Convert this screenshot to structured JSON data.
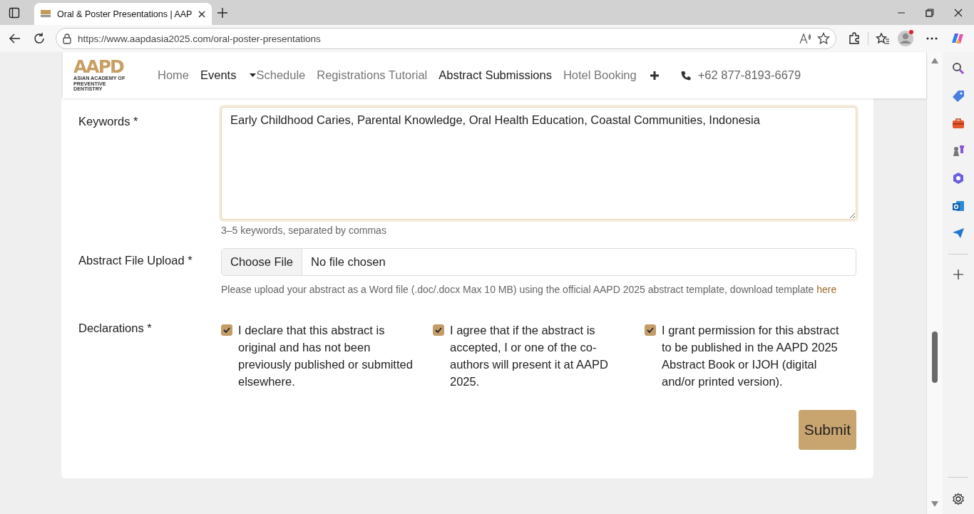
{
  "browser": {
    "tab": {
      "title": "Oral & Poster Presentations | AAP",
      "selected": true
    },
    "url": "https://www.aapdasia2025.com/oral-poster-presentations"
  },
  "site_header": {
    "logo": {
      "mark": "AAPD",
      "subtitle": "ASIAN ACADEMY OF PREVENTIVE DENTISTRY"
    },
    "nav": [
      {
        "label": "Home",
        "kind": "link",
        "selected": false
      },
      {
        "label": "Events",
        "kind": "dropdown",
        "selected": true
      },
      {
        "label": "Schedule",
        "kind": "link",
        "selected": false
      },
      {
        "label": "Registrations Tutorial",
        "kind": "link",
        "selected": false
      },
      {
        "label": "Abstract Submissions",
        "kind": "link",
        "selected": true
      },
      {
        "label": "Hotel Booking",
        "kind": "link",
        "selected": false
      }
    ],
    "phone": "+62 877-8193-6679"
  },
  "form": {
    "keywords": {
      "label": "Keywords",
      "required_mark": "*",
      "value": "Early Childhood Caries, Parental Knowledge, Oral Health Education, Coastal Communities, Indonesia",
      "hint": "3–5 keywords, separated by commas"
    },
    "upload": {
      "label": "Abstract File Upload",
      "required_mark": "*",
      "button": "Choose File",
      "status": "No file chosen",
      "help": "Please upload your abstract as a Word file (.doc/.docx Max 10 MB) using the official AAPD 2025 abstract template, download template",
      "link": "here"
    },
    "declarations": {
      "label": "Declarations",
      "required_mark": "*",
      "items": [
        {
          "text": "I declare that this abstract is original and has not been previously published or submitted elsewhere.",
          "checked": true
        },
        {
          "text": "I agree that if the abstract is accepted, I or one of the co-authors will present it at AAPD 2025.",
          "checked": true
        },
        {
          "text": "I grant permission for this abstract to be published in the AAPD 2025 Abstract Book or IJOH (digital and/or printed version).",
          "checked": true
        }
      ]
    },
    "submit": "Submit"
  }
}
